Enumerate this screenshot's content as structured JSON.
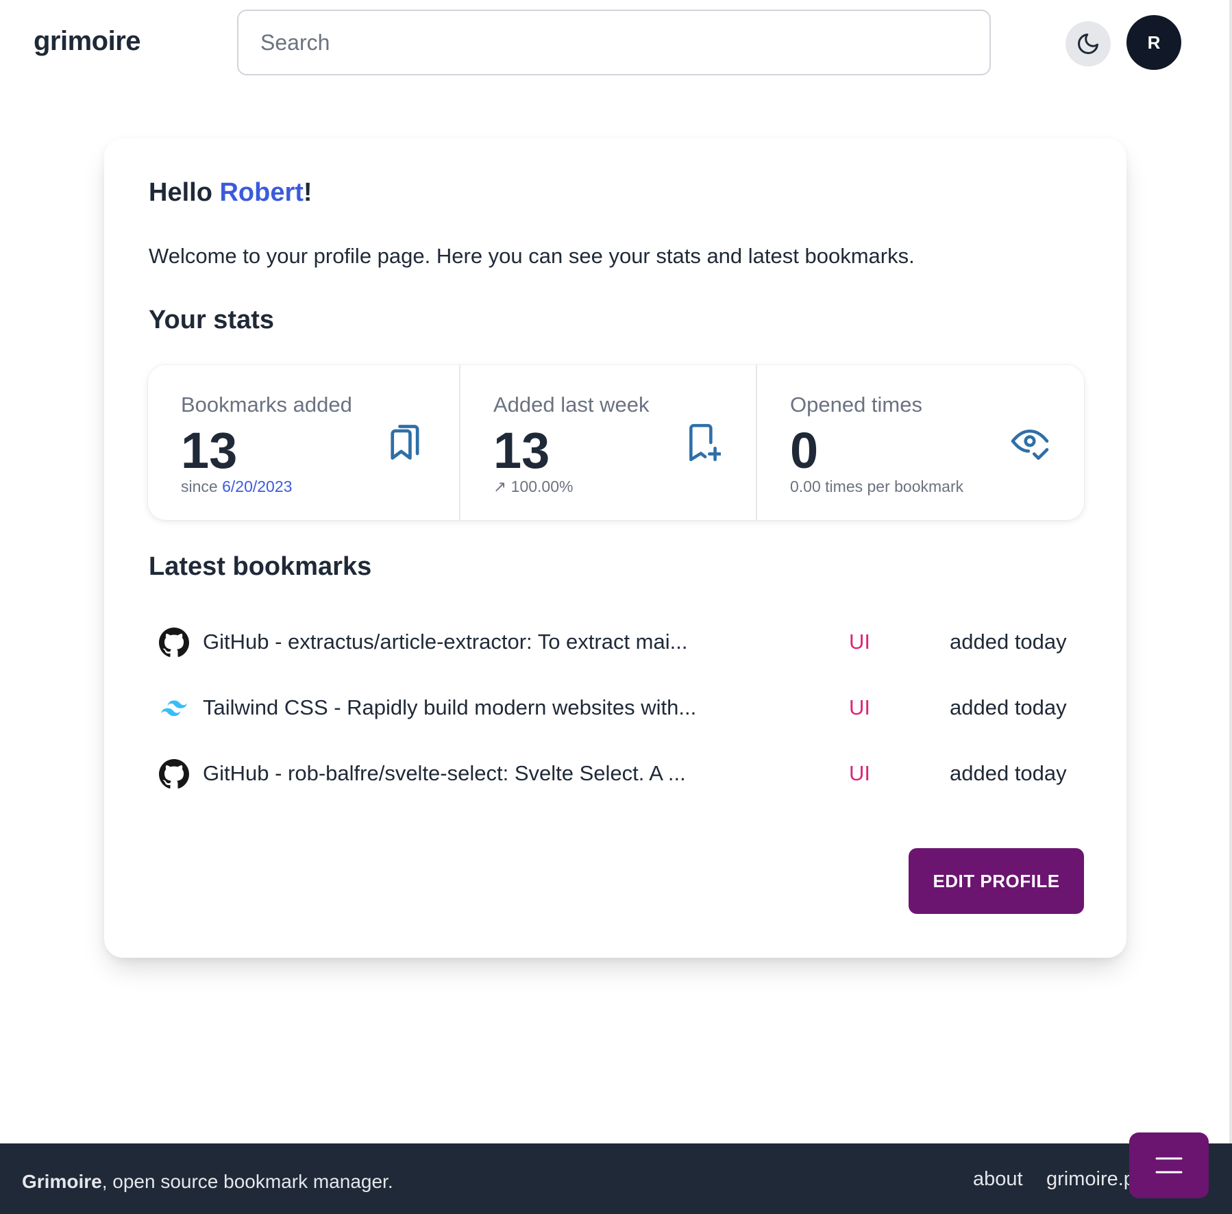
{
  "header": {
    "logo": "grimoire",
    "search_placeholder": "Search",
    "theme_toggle_icon": "moon-icon",
    "avatar_initial": "R"
  },
  "profile": {
    "greeting_prefix": "Hello ",
    "user_name": "Robert",
    "greeting_suffix": "!",
    "welcome": "Welcome to your profile page. Here you can see your stats and latest bookmarks.",
    "stats_title": "Your stats",
    "stats": [
      {
        "title": "Bookmarks added",
        "value": "13",
        "desc_prefix": "since ",
        "desc_date": "6/20/2023",
        "icon": "bookmarks-icon"
      },
      {
        "title": "Added last week",
        "value": "13",
        "desc_arrow": "↗",
        "desc": "100.00%",
        "icon": "bookmark-plus-icon"
      },
      {
        "title": "Opened times",
        "value": "0",
        "desc": "0.00 times per bookmark",
        "icon": "eye-check-icon"
      }
    ],
    "latest_title": "Latest bookmarks",
    "bookmarks": [
      {
        "title": "GitHub - extractus/article-extractor: To extract mai...",
        "tag": "UI",
        "added": "added today",
        "favicon": "github-icon"
      },
      {
        "title": "Tailwind CSS - Rapidly build modern websites with...",
        "tag": "UI",
        "added": "added today",
        "favicon": "tailwind-icon"
      },
      {
        "title": "GitHub - rob-balfre/svelte-select: Svelte Select. A ...",
        "tag": "UI",
        "added": "added today",
        "favicon": "github-icon"
      }
    ],
    "edit_button": "EDIT PROFILE"
  },
  "footer": {
    "brand": "Grimoire",
    "tagline": ", open source bookmark manager.",
    "links": [
      "about",
      "grimoire.p"
    ],
    "fab_icon": "menu-icon"
  },
  "colors": {
    "accent_purple": "#6b1570",
    "link_blue": "#3b5bdb",
    "tag_pink": "#db2777",
    "stat_icon_blue": "#2f6fa8",
    "footer_bg": "#1f2937"
  }
}
